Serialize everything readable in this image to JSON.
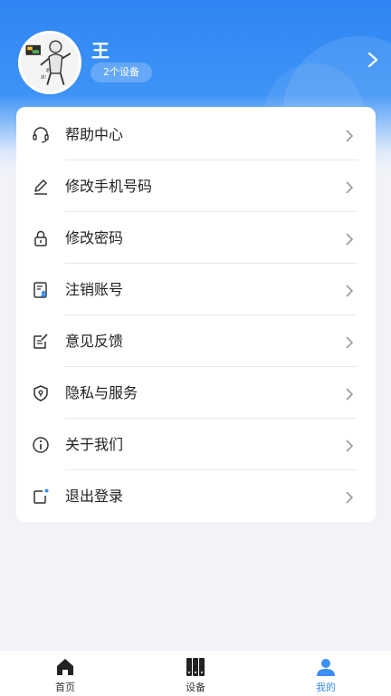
{
  "profile": {
    "username": "王",
    "device_badge": "2个设备",
    "avatar_icon": "avatar-image",
    "arrow_icon": "chevron-right-icon"
  },
  "menu": {
    "items": [
      {
        "label": "帮助中心",
        "icon": "headset-icon"
      },
      {
        "label": "修改手机号码",
        "icon": "pencil-icon"
      },
      {
        "label": "修改密码",
        "icon": "lock-icon"
      },
      {
        "label": "注销账号",
        "icon": "user-card-icon"
      },
      {
        "label": "意见反馈",
        "icon": "feedback-edit-icon"
      },
      {
        "label": "隐私与服务",
        "icon": "shield-icon"
      },
      {
        "label": "关于我们",
        "icon": "info-icon"
      },
      {
        "label": "退出登录",
        "icon": "logout-icon"
      }
    ]
  },
  "tabbar": {
    "tabs": [
      {
        "label": "首页",
        "icon": "home-icon",
        "active": false
      },
      {
        "label": "设备",
        "icon": "device-icon",
        "active": false
      },
      {
        "label": "我的",
        "icon": "user-icon",
        "active": true
      }
    ]
  },
  "colors": {
    "primary": "#3a8ff5",
    "header_gradient_top": "#2f86f4",
    "background": "#f1f3f8"
  }
}
